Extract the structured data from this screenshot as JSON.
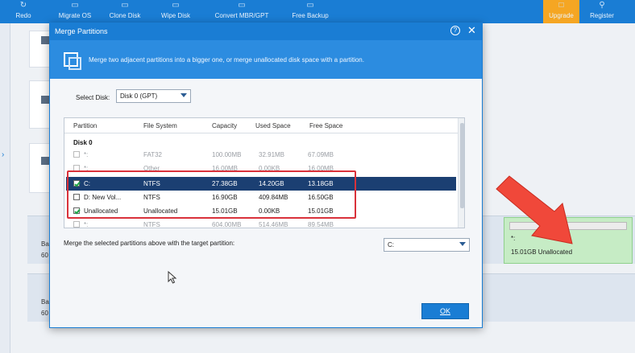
{
  "toolbar": {
    "items": [
      {
        "label": "Redo"
      },
      {
        "label": "Migrate OS"
      },
      {
        "label": "Clone Disk"
      },
      {
        "label": "Wipe Disk"
      },
      {
        "label": "Convert MBR/GPT"
      },
      {
        "label": "Free Backup"
      },
      {
        "label": "Upgrade"
      },
      {
        "label": "Register"
      }
    ]
  },
  "background": {
    "disk_rows": [
      {
        "line1": "Ba",
        "line2": "60"
      },
      {
        "line1": "Ba",
        "line2": "60"
      }
    ],
    "unallocated_box": {
      "label": "*:",
      "sub": "15.01GB Unallocated"
    }
  },
  "dialog": {
    "title": "Merge Partitions",
    "help_glyph": "?",
    "close_glyph": "✕",
    "banner_text": "Merge two adjacent partitions into a bigger one, or merge unallocated disk space with a partition.",
    "select_disk_label": "Select Disk:",
    "select_disk_value": "Disk 0 (GPT)",
    "columns": [
      "Partition",
      "File System",
      "Capacity",
      "Used Space",
      "Free Space"
    ],
    "disk_label": "Disk 0",
    "rows": [
      {
        "partition": "*:",
        "fs": "FAT32",
        "capacity": "100.00MB",
        "used": "32.91MB",
        "free": "67.09MB",
        "checked": false,
        "state": "dim"
      },
      {
        "partition": "*:",
        "fs": "Other",
        "capacity": "16.00MB",
        "used": "0.00KB",
        "free": "16.00MB",
        "checked": false,
        "state": "dim"
      },
      {
        "partition": "C:",
        "fs": "NTFS",
        "capacity": "27.38GB",
        "used": "14.20GB",
        "free": "13.18GB",
        "checked": true,
        "state": "selected"
      },
      {
        "partition": "D:  New Vol...",
        "fs": "NTFS",
        "capacity": "16.90GB",
        "used": "409.84MB",
        "free": "16.50GB",
        "checked": false,
        "state": "normal"
      },
      {
        "partition": "Unallocated",
        "fs": "Unallocated",
        "capacity": "15.01GB",
        "used": "0.00KB",
        "free": "15.01GB",
        "checked": true,
        "state": "normal"
      },
      {
        "partition": "*:",
        "fs": "NTFS",
        "capacity": "604.00MB",
        "used": "514.46MB",
        "free": "89.54MB",
        "checked": false,
        "state": "dim"
      }
    ],
    "merge_label": "Merge the selected partitions above with the target partition:",
    "target_value": "C:",
    "ok_label": "OK"
  },
  "colors": {
    "accent": "#1a7dd4",
    "selection": "#1b3f72",
    "highlight": "#d9323b",
    "arrow": "#f0483a",
    "unallocated": "#c6ecc5"
  }
}
